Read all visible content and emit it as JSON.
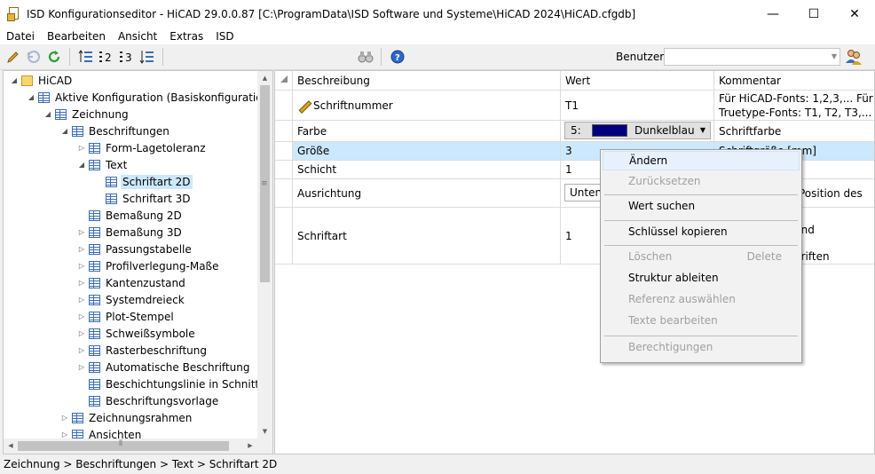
{
  "window": {
    "title": "ISD Konfigurationseditor  - HiCAD 29.0.0.87 [C:\\ProgramData\\ISD Software und Systeme\\HiCAD 2024\\HiCAD.cfgdb]",
    "minimize": "—",
    "maximize": "☐",
    "close": "✕"
  },
  "menu": [
    "Datei",
    "Bearbeiten",
    "Ansicht",
    "Extras",
    "ISD"
  ],
  "toolbar": {
    "user_label": "Benutzer",
    "user_value": ""
  },
  "tree": [
    {
      "label": "HiCAD",
      "exp": "◢",
      "icon": "folder",
      "level": 0
    },
    {
      "label": "Aktive Konfiguration (Basiskonfiguration)",
      "exp": "◢",
      "icon": "table",
      "level": 1
    },
    {
      "label": "Zeichnung",
      "exp": "◢",
      "icon": "table",
      "level": 2
    },
    {
      "label": "Beschriftungen",
      "exp": "◢",
      "icon": "table",
      "level": 3
    },
    {
      "label": "Form-Lagetoleranz",
      "exp": "▷",
      "icon": "table",
      "level": 4
    },
    {
      "label": "Text",
      "exp": "◢",
      "icon": "table",
      "level": 4
    },
    {
      "label": "Schriftart 2D",
      "exp": "",
      "icon": "table",
      "level": 5,
      "selected": true
    },
    {
      "label": "Schriftart 3D",
      "exp": "",
      "icon": "table",
      "level": 5
    },
    {
      "label": "Bemaßung 2D",
      "exp": "",
      "icon": "table",
      "level": 4
    },
    {
      "label": "Bemaßung 3D",
      "exp": "▷",
      "icon": "table",
      "level": 4
    },
    {
      "label": "Passungstabelle",
      "exp": "▷",
      "icon": "table",
      "level": 4
    },
    {
      "label": "Profilverlegung-Maße",
      "exp": "▷",
      "icon": "table",
      "level": 4
    },
    {
      "label": "Kantenzustand",
      "exp": "▷",
      "icon": "table",
      "level": 4
    },
    {
      "label": "Systemdreieck",
      "exp": "▷",
      "icon": "table",
      "level": 4
    },
    {
      "label": "Plot-Stempel",
      "exp": "▷",
      "icon": "table",
      "level": 4
    },
    {
      "label": "Schweißsymbole",
      "exp": "▷",
      "icon": "table",
      "level": 4
    },
    {
      "label": "Rasterbeschriftung",
      "exp": "▷",
      "icon": "table",
      "level": 4
    },
    {
      "label": "Automatische Beschriftung",
      "exp": "▷",
      "icon": "table",
      "level": 4
    },
    {
      "label": "Beschichtungslinie in Schnittansi",
      "exp": "",
      "icon": "table",
      "level": 4
    },
    {
      "label": "Beschriftungsvorlage",
      "exp": "",
      "icon": "table",
      "level": 4
    },
    {
      "label": "Zeichnungsrahmen",
      "exp": "▷",
      "icon": "table",
      "level": 3
    },
    {
      "label": "Ansichten",
      "exp": "▷",
      "icon": "table",
      "level": 3
    }
  ],
  "grid": {
    "headers": {
      "desc": "Beschreibung",
      "val": "Wert",
      "com": "Kommentar"
    },
    "rows": {
      "schriftnummer": {
        "desc": "Schriftnummer",
        "val": "T1",
        "com": "Für HiCAD-Fonts: 1,2,3,... Für Truetype-Fonts: T1, T2, T3,..."
      },
      "farbe": {
        "desc": "Farbe",
        "val_num": "5:",
        "val_name": "Dunkelblau",
        "swatch": "#00007f",
        "com": "Schriftfarbe"
      },
      "groesse": {
        "desc": "Größe",
        "val": "3",
        "com": "Schriftgröße [mm]"
      },
      "schicht": {
        "desc": "Schicht",
        "val": "1",
        "com": ""
      },
      "ausrichtung": {
        "desc": "Ausrichtung",
        "val": "Unten,",
        "com": "Position des"
      },
      "schriftart": {
        "desc": "Schriftart",
        "val": "1",
        "com_line1": "und",
        "com_line2": "hriften"
      }
    }
  },
  "context_menu": {
    "aendern": "Ändern",
    "zuruecksetzen": "Zurücksetzen",
    "wert_suchen": "Wert suchen",
    "schluessel_kopieren": "Schlüssel kopieren",
    "loeschen": "Löschen",
    "loeschen_shortcut": "Delete",
    "struktur_ableiten": "Struktur ableiten",
    "referenz_auswaehlen": "Referenz auswählen",
    "texte_bearbeiten": "Texte bearbeiten",
    "berechtigungen": "Berechtigungen"
  },
  "status": "Zeichnung > Beschriftungen > Text > Schriftart 2D"
}
